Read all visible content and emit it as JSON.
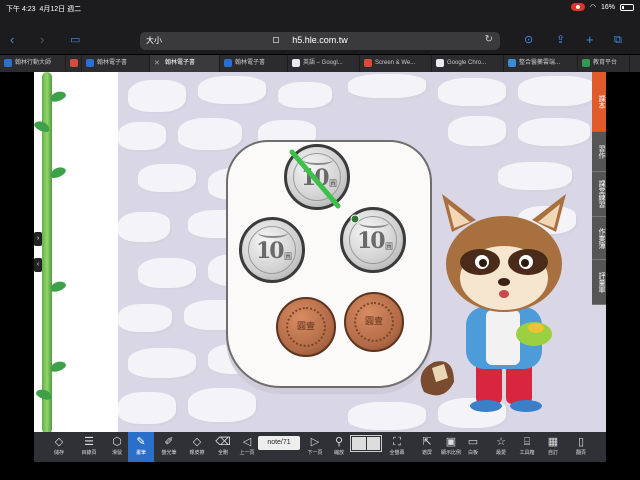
{
  "status_bar": {
    "time": "下午 4:23",
    "date": "4月12日 週二",
    "wifi": "Wi-Fi",
    "battery": "16%"
  },
  "browser": {
    "text_size_label": "大小",
    "url": "h5.hle.com.tw",
    "tabs": [
      {
        "label": "翰林行動大師",
        "fav_color": "#2b6fd0"
      },
      {
        "label": "",
        "fav_color": "#d05040"
      },
      {
        "label": "翰林電子書",
        "fav_color": "#2b6fd0"
      },
      {
        "label": "翰林電子書",
        "fav_color": "#888888",
        "active": true
      },
      {
        "label": "翰林電子書",
        "fav_color": "#2b6fd0"
      },
      {
        "label": "英語 – Googl...",
        "fav_color": "#e8eaed"
      },
      {
        "label": "Screen & We...",
        "fav_color": "#d94a3a"
      },
      {
        "label": "Google Chro...",
        "fav_color": "#e8eaed"
      },
      {
        "label": "整合醫藥雲端...",
        "fav_color": "#3a8cd9"
      },
      {
        "label": "教育平台",
        "fav_color": "#2f9a52"
      }
    ]
  },
  "ebook": {
    "coins": {
      "ten_value": "10",
      "ten_unit": "圓",
      "one_text": "圓壹"
    },
    "side_tabs": [
      {
        "label": "課本",
        "color": "#e05a2a"
      },
      {
        "label": "習作",
        "color": "#555555"
      },
      {
        "label": "課堂練習",
        "color": "#555555"
      },
      {
        "label": "作業簿",
        "color": "#555555"
      },
      {
        "label": "評量單",
        "color": "#555555"
      }
    ],
    "toolbar": {
      "page_label": "note/71",
      "tools": [
        {
          "label": "儲存",
          "icon": "eraser-icon"
        },
        {
          "label": "目錄頁",
          "icon": "toc-icon"
        },
        {
          "label": "滑鼠",
          "icon": "pointer-icon"
        },
        {
          "label": "畫筆",
          "icon": "pen-icon",
          "active": true
        },
        {
          "label": "螢光筆",
          "icon": "highlighter-icon"
        },
        {
          "label": "橡皮擦",
          "icon": "eraser-icon"
        },
        {
          "label": "全刪",
          "icon": "trash-icon"
        },
        {
          "label": "上一頁",
          "icon": "prev-icon"
        },
        {
          "label": "下一頁",
          "icon": "next-icon"
        },
        {
          "label": "縮放",
          "icon": "zoom-icon"
        },
        {
          "label": "全螢幕",
          "icon": "fullscreen-icon"
        },
        {
          "label": "遮屏",
          "icon": "screen-icon"
        },
        {
          "label": "顯示比例",
          "icon": "ratio-icon"
        },
        {
          "label": "白板",
          "icon": "whiteboard-icon"
        },
        {
          "label": "最愛",
          "icon": "star-icon"
        },
        {
          "label": "工具箱",
          "icon": "toolbox-icon"
        },
        {
          "label": "自訂",
          "icon": "custom-icon"
        },
        {
          "label": "翻頁",
          "icon": "book-icon"
        }
      ]
    },
    "colors": {
      "pen_stroke": "#3cc04a",
      "active_tool": "#2a6fc9",
      "toolbar_bg": "#2f3136"
    }
  }
}
